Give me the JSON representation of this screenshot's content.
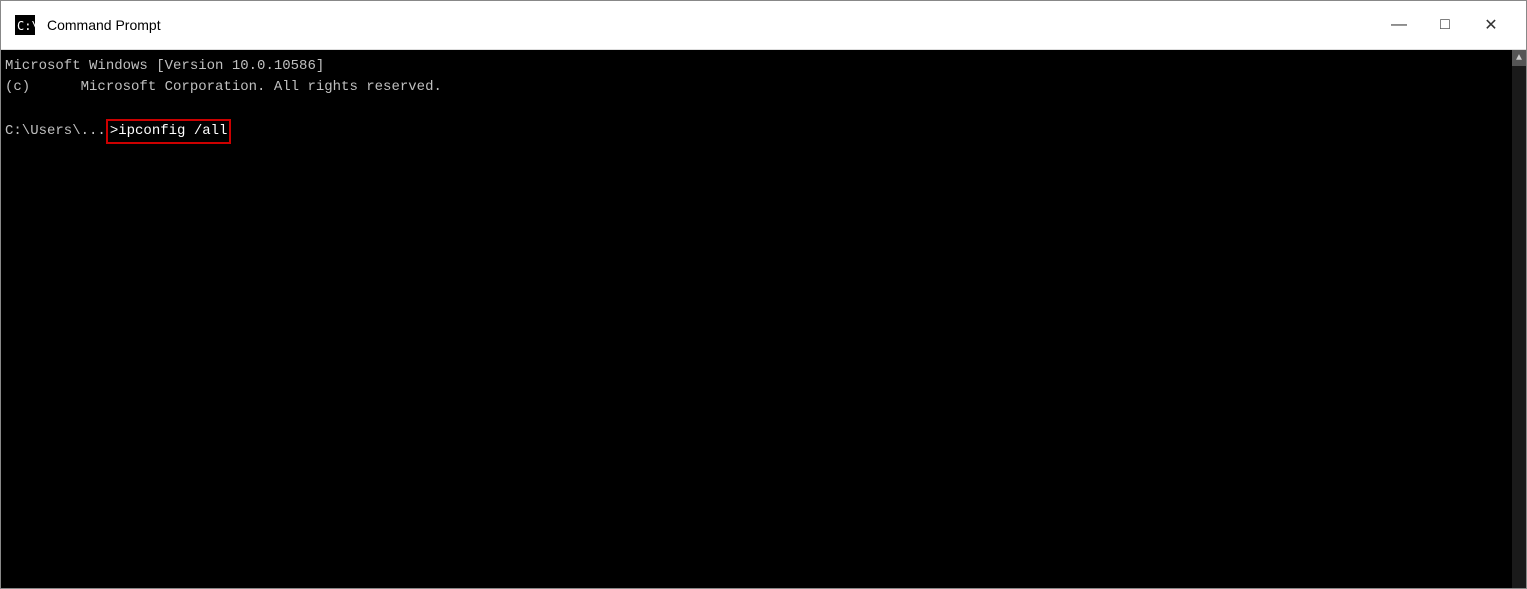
{
  "window": {
    "title": "Command Prompt",
    "icon_label": "cmd-icon"
  },
  "controls": {
    "minimize": "—",
    "maximize": "□",
    "close": "✕"
  },
  "terminal": {
    "line1": "Microsoft Windows [Version 10.0.10586]",
    "line2": "(c)      Microsoft Corporation. All rights reserved.",
    "line3": "",
    "prompt": "C:\\Users\\...",
    "command": ">ipconfig /all"
  }
}
